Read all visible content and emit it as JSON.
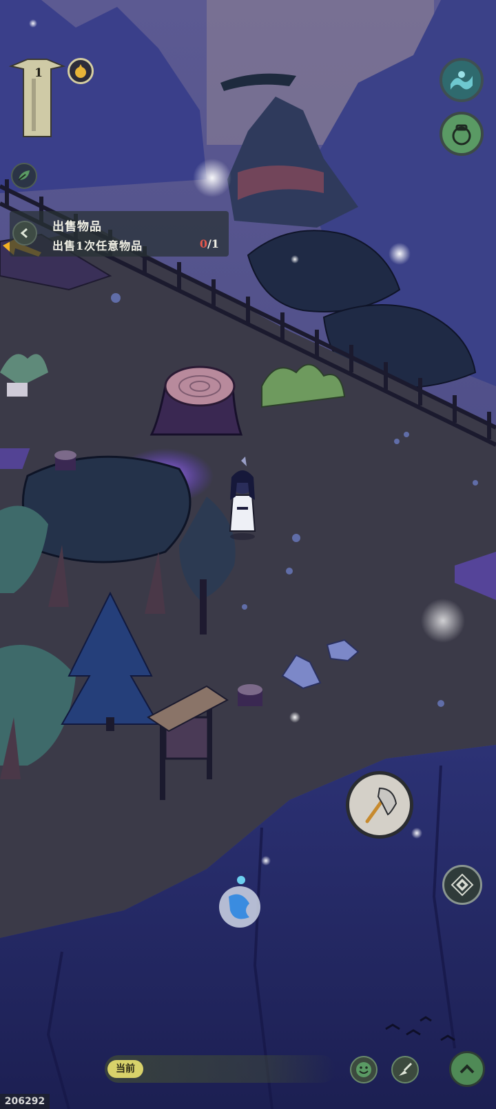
{
  "hud": {
    "level": "1",
    "quest": {
      "title": "出售物品",
      "description": "出售1次任意物品",
      "progress_current": "0",
      "progress_total": "/1"
    },
    "chat": {
      "channel": "当前",
      "message": ""
    },
    "user_id": "206292"
  },
  "icons": {
    "top_right_1": "wave-talisman-icon",
    "top_right_2": "pouch-icon",
    "side_leaf": "leaf-icon",
    "collapse": "chevron-left-icon",
    "action": "axe-icon",
    "dodge": "compass-diamond-icon",
    "emote": "smile-icon",
    "skill": "brush-icon",
    "expand": "chevron-up-icon"
  },
  "colors": {
    "night_sky": "#4a4a8a",
    "grass": "#3a3a47",
    "cliff": "#2b2e6e",
    "accent_green": "#5a9a64",
    "progress_red": "#e2574c"
  }
}
